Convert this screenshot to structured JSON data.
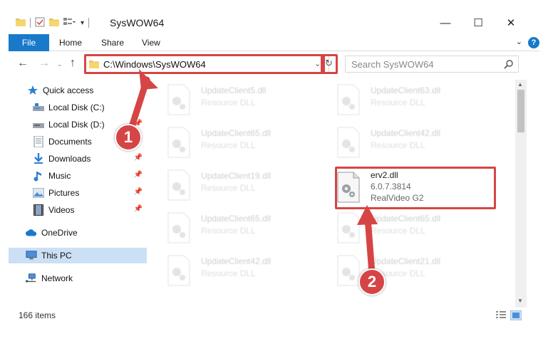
{
  "window": {
    "title": "SysWOW64",
    "minimize": "—",
    "maximize": "☐",
    "close": "✕"
  },
  "ribbon": {
    "tabs": [
      "File",
      "Home",
      "Share",
      "View"
    ],
    "help": "?"
  },
  "address": {
    "path": "C:\\Windows\\SysWOW64",
    "search_placeholder": "Search SysWOW64"
  },
  "sidebar": {
    "items": [
      {
        "label": "Quick access",
        "icon": "star-icon",
        "pinned": false
      },
      {
        "label": "Local Disk (C:)",
        "icon": "drive-icon",
        "pinned": true
      },
      {
        "label": "Local Disk (D:)",
        "icon": "drive-icon",
        "pinned": true
      },
      {
        "label": "Documents",
        "icon": "documents-icon",
        "pinned": true
      },
      {
        "label": "Downloads",
        "icon": "download-icon",
        "pinned": true
      },
      {
        "label": "Music",
        "icon": "music-icon",
        "pinned": true
      },
      {
        "label": "Pictures",
        "icon": "pictures-icon",
        "pinned": true
      },
      {
        "label": "Videos",
        "icon": "videos-icon",
        "pinned": true
      },
      {
        "label": "OneDrive",
        "icon": "cloud-icon",
        "pinned": false
      },
      {
        "label": "This PC",
        "icon": "computer-icon",
        "pinned": false,
        "selected": true
      },
      {
        "label": "Network",
        "icon": "network-icon",
        "pinned": false
      }
    ]
  },
  "files": [
    {
      "name": "UpdateClient5.dll",
      "desc": "Resource DLL",
      "faded": true
    },
    {
      "name": "UpdateClient63.dll",
      "desc": "Resource DLL",
      "faded": true
    },
    {
      "name": "UpdateClient65.dll",
      "desc": "Resource DLL",
      "faded": true
    },
    {
      "name": "UpdateClient42.dll",
      "desc": "Resource DLL",
      "faded": true
    },
    {
      "name": "UpdateClient19.dll",
      "desc": "Resource DLL",
      "faded": true
    },
    {
      "name": "erv2.dll",
      "version": "6.0.7.3814",
      "desc": "RealVideo G2",
      "faded": false,
      "highlighted": true
    },
    {
      "name": "UpdateClient65.dll",
      "desc": "Resource DLL",
      "faded": true
    },
    {
      "name": "UpdateClient65.dll",
      "desc": "Resource DLL",
      "faded": true
    },
    {
      "name": "UpdateClient42.dll",
      "desc": "Resource DLL",
      "faded": true
    },
    {
      "name": "UpdateClient21.dll",
      "desc": "Resource DLL",
      "faded": true
    }
  ],
  "status": {
    "item_count": "166 items"
  },
  "annotations": {
    "step1": "1",
    "step2": "2"
  },
  "colors": {
    "accent": "#1979ca",
    "highlight": "#d64545",
    "selected": "#cce0f5"
  }
}
